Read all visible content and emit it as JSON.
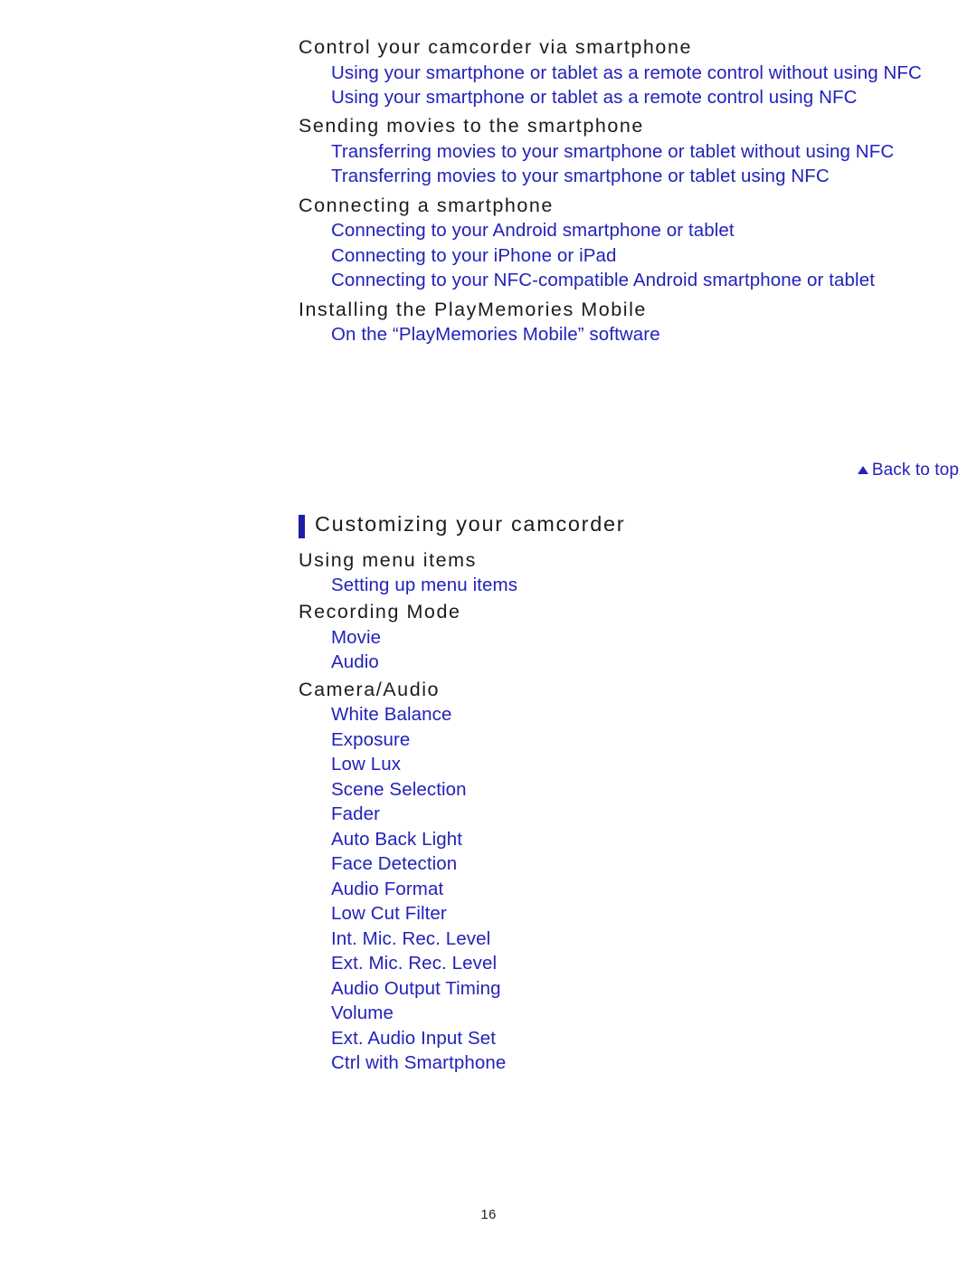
{
  "document": {
    "page_number": "16",
    "link_color": "#2222bb",
    "heading_color": "#1c1c1c",
    "accent_bar_color": "#1e1ea8",
    "background_color": "#ffffff"
  },
  "toc_top": {
    "groups": [
      {
        "heading": "Control your camcorder via smartphone",
        "links": [
          "Using your smartphone or tablet as a remote control without using NFC",
          "Using your smartphone or tablet as a remote control using NFC"
        ]
      },
      {
        "heading": "Sending movies to the smartphone",
        "links": [
          "Transferring movies to your smartphone or tablet without using NFC",
          "Transferring movies to your smartphone or tablet using NFC"
        ]
      },
      {
        "heading": "Connecting a smartphone",
        "links": [
          "Connecting to your Android smartphone or tablet",
          "Connecting to your iPhone or iPad",
          "Connecting to your NFC-compatible Android smartphone or tablet"
        ]
      },
      {
        "heading": "Installing the PlayMemories Mobile",
        "links": [
          "On the “PlayMemories Mobile” software"
        ]
      }
    ]
  },
  "back_to_top": {
    "label": "Back to top",
    "icon": "triangle-up-icon"
  },
  "section": {
    "title": "Customizing your camcorder",
    "groups": [
      {
        "heading": "Using menu items",
        "links": [
          "Setting up menu items"
        ]
      },
      {
        "heading": "Recording Mode",
        "links": [
          "Movie",
          "Audio"
        ]
      },
      {
        "heading": "Camera/Audio",
        "links": [
          "White Balance",
          "Exposure",
          "Low Lux",
          "Scene Selection",
          "Fader",
          "Auto Back Light",
          "Face Detection",
          "Audio Format",
          "Low Cut Filter",
          "Int. Mic. Rec. Level",
          "Ext. Mic. Rec. Level",
          "Audio Output Timing",
          "Volume",
          "Ext. Audio Input Set",
          "Ctrl with Smartphone"
        ]
      }
    ]
  }
}
